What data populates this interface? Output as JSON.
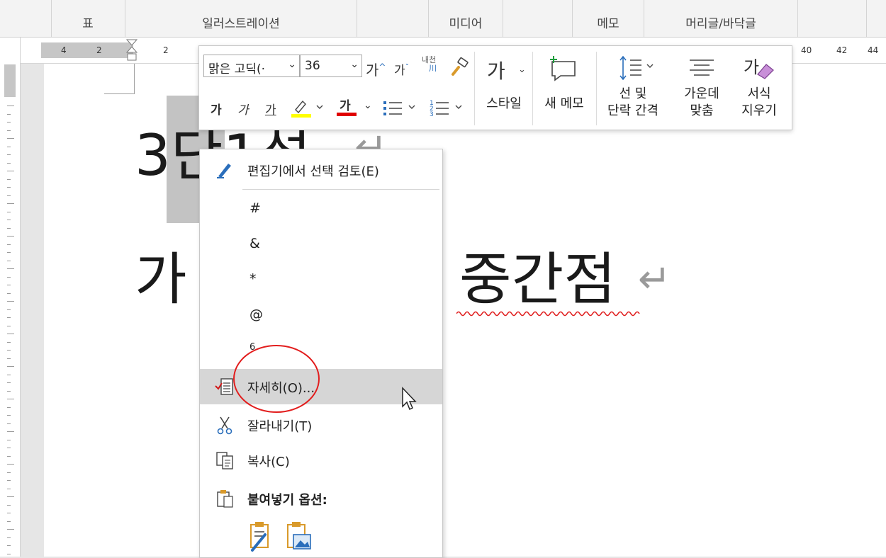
{
  "ribbon": {
    "groups": [
      "표",
      "일러스트레이션",
      "미디어",
      "메모",
      "머리글/바닥글"
    ]
  },
  "ruler": {
    "ticks": [
      "4",
      "2",
      "2",
      "40",
      "42",
      "44"
    ]
  },
  "document": {
    "line1_text": "3단1설",
    "line2_text": "가",
    "line2_word": "중간점",
    "paragraph_mark": "↵"
  },
  "mini_toolbar": {
    "font_name": "맑은 고딕(·",
    "font_size": "36",
    "grow_font": "가",
    "shrink_font": "가",
    "phonetic": "내천",
    "bold": "가",
    "italic": "가",
    "underline": "가",
    "font_color_char": "가",
    "style_glyph": "가",
    "style_label": "스타일",
    "new_comment_label": "새 메모",
    "spacing_label_1": "선 및",
    "spacing_label_2": "단락 간격",
    "center_label_1": "가운데",
    "center_label_2": "맞춤",
    "clear_glyph": "가",
    "clear_label_1": "서식",
    "clear_label_2": "지우기",
    "highlight_color": "#ffff00",
    "font_color": "#e00000"
  },
  "context_menu": {
    "items": [
      {
        "label": "편집기에서 선택 검토(E)",
        "icon": "editor-pen-icon"
      },
      {
        "label": "#"
      },
      {
        "label": "&"
      },
      {
        "label": "*"
      },
      {
        "label": "@"
      },
      {
        "label": "6"
      },
      {
        "label": "자세히(O)...",
        "icon": "details-icon",
        "highlighted": true
      },
      {
        "label": "잘라내기(T)",
        "icon": "scissors-icon"
      },
      {
        "label": "복사(C)",
        "icon": "copy-icon"
      },
      {
        "label": "붙여넣기 옵션:",
        "icon": "paste-icon",
        "bold": true
      }
    ]
  },
  "annotation_color": "#e21d1d"
}
